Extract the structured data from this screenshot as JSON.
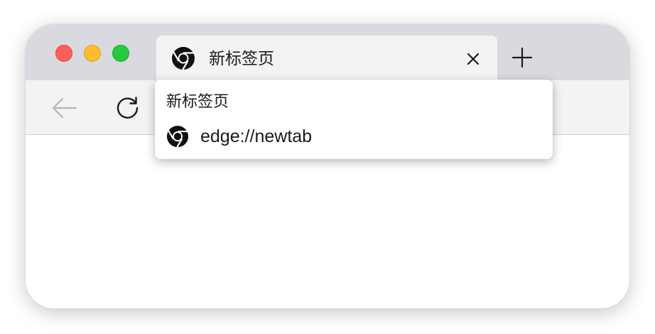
{
  "window": {
    "controls": {
      "close_color": "#fe5f57",
      "minimize_color": "#febc2e",
      "maximize_color": "#28c840"
    }
  },
  "tab": {
    "title": "新标签页",
    "favicon": "chrome-icon",
    "close_icon": "close-icon"
  },
  "tabstrip": {
    "new_tab_icon": "plus-icon"
  },
  "toolbar": {
    "back_icon": "back-arrow-icon",
    "reload_icon": "reload-icon"
  },
  "hovercard": {
    "title": "新标签页",
    "favicon": "chrome-icon",
    "url": "edge://newtab"
  }
}
